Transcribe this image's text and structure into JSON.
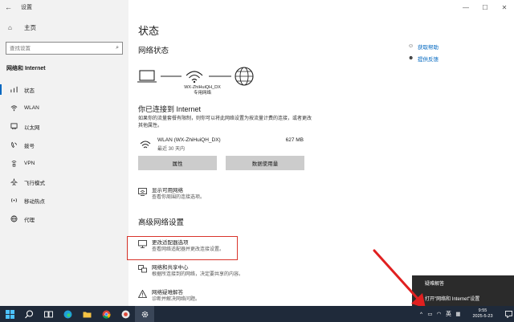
{
  "window": {
    "title": "设置",
    "controls": [
      "—",
      "☐",
      "✕"
    ]
  },
  "sidebar": {
    "home_label": "主页",
    "search_placeholder": "查找设置",
    "section_title": "网络和 Internet",
    "items": [
      {
        "label": "状态",
        "icon": "status-icon"
      },
      {
        "label": "WLAN",
        "icon": "wifi-icon"
      },
      {
        "label": "以太网",
        "icon": "ethernet-icon"
      },
      {
        "label": "拨号",
        "icon": "dialup-icon"
      },
      {
        "label": "VPN",
        "icon": "vpn-icon"
      },
      {
        "label": "飞行模式",
        "icon": "airplane-icon"
      },
      {
        "label": "移动热点",
        "icon": "hotspot-icon"
      },
      {
        "label": "代理",
        "icon": "globe-icon"
      }
    ]
  },
  "main": {
    "title": "状态",
    "network_status_title": "网络状态",
    "network_name": "WX-ZhiHuiQH_DX",
    "network_type": "专用网络",
    "connected_title": "你已连接到 Internet",
    "connected_desc": "如果你的流量套餐有限制，则你可以将此网络设置为按流量计费的连接，或者更改其他属性。",
    "wlan": {
      "name": "WLAN (WX-ZhiHuiQH_DX)",
      "sub": "最近 30 天内",
      "usage": "627 MB"
    },
    "buttons": {
      "properties": "属性",
      "data_usage": "数据使用量"
    },
    "show_networks": {
      "title": "显示可用网络",
      "sub": "查看你周围的连接选项。"
    },
    "advanced_title": "高级网络设置",
    "adapter": {
      "title": "更改适配器选项",
      "sub": "查看网络适配器并更改连接设置。"
    },
    "sharing": {
      "title": "网络和共享中心",
      "sub": "根据所连接到的网络，决定要共享的内容。"
    },
    "troubleshooter": {
      "title": "网络疑难解答",
      "sub": "诊断并解决网络问题。"
    }
  },
  "right_links": [
    {
      "label": "获取帮助",
      "icon": "help-icon"
    },
    {
      "label": "提供反馈",
      "icon": "feedback-icon"
    }
  ],
  "tray_menu": {
    "items": [
      "疑难解答",
      "打开\"网络和 Internet\"设置"
    ]
  },
  "taskbar": {
    "lang": "英",
    "time": "9:55",
    "date": "2025-5-23"
  },
  "colors": {
    "accent": "#0067c0",
    "highlight_border": "#d9342b",
    "taskbar": "#1f2a3a",
    "sidebar_bg": "#f2f2f2"
  }
}
